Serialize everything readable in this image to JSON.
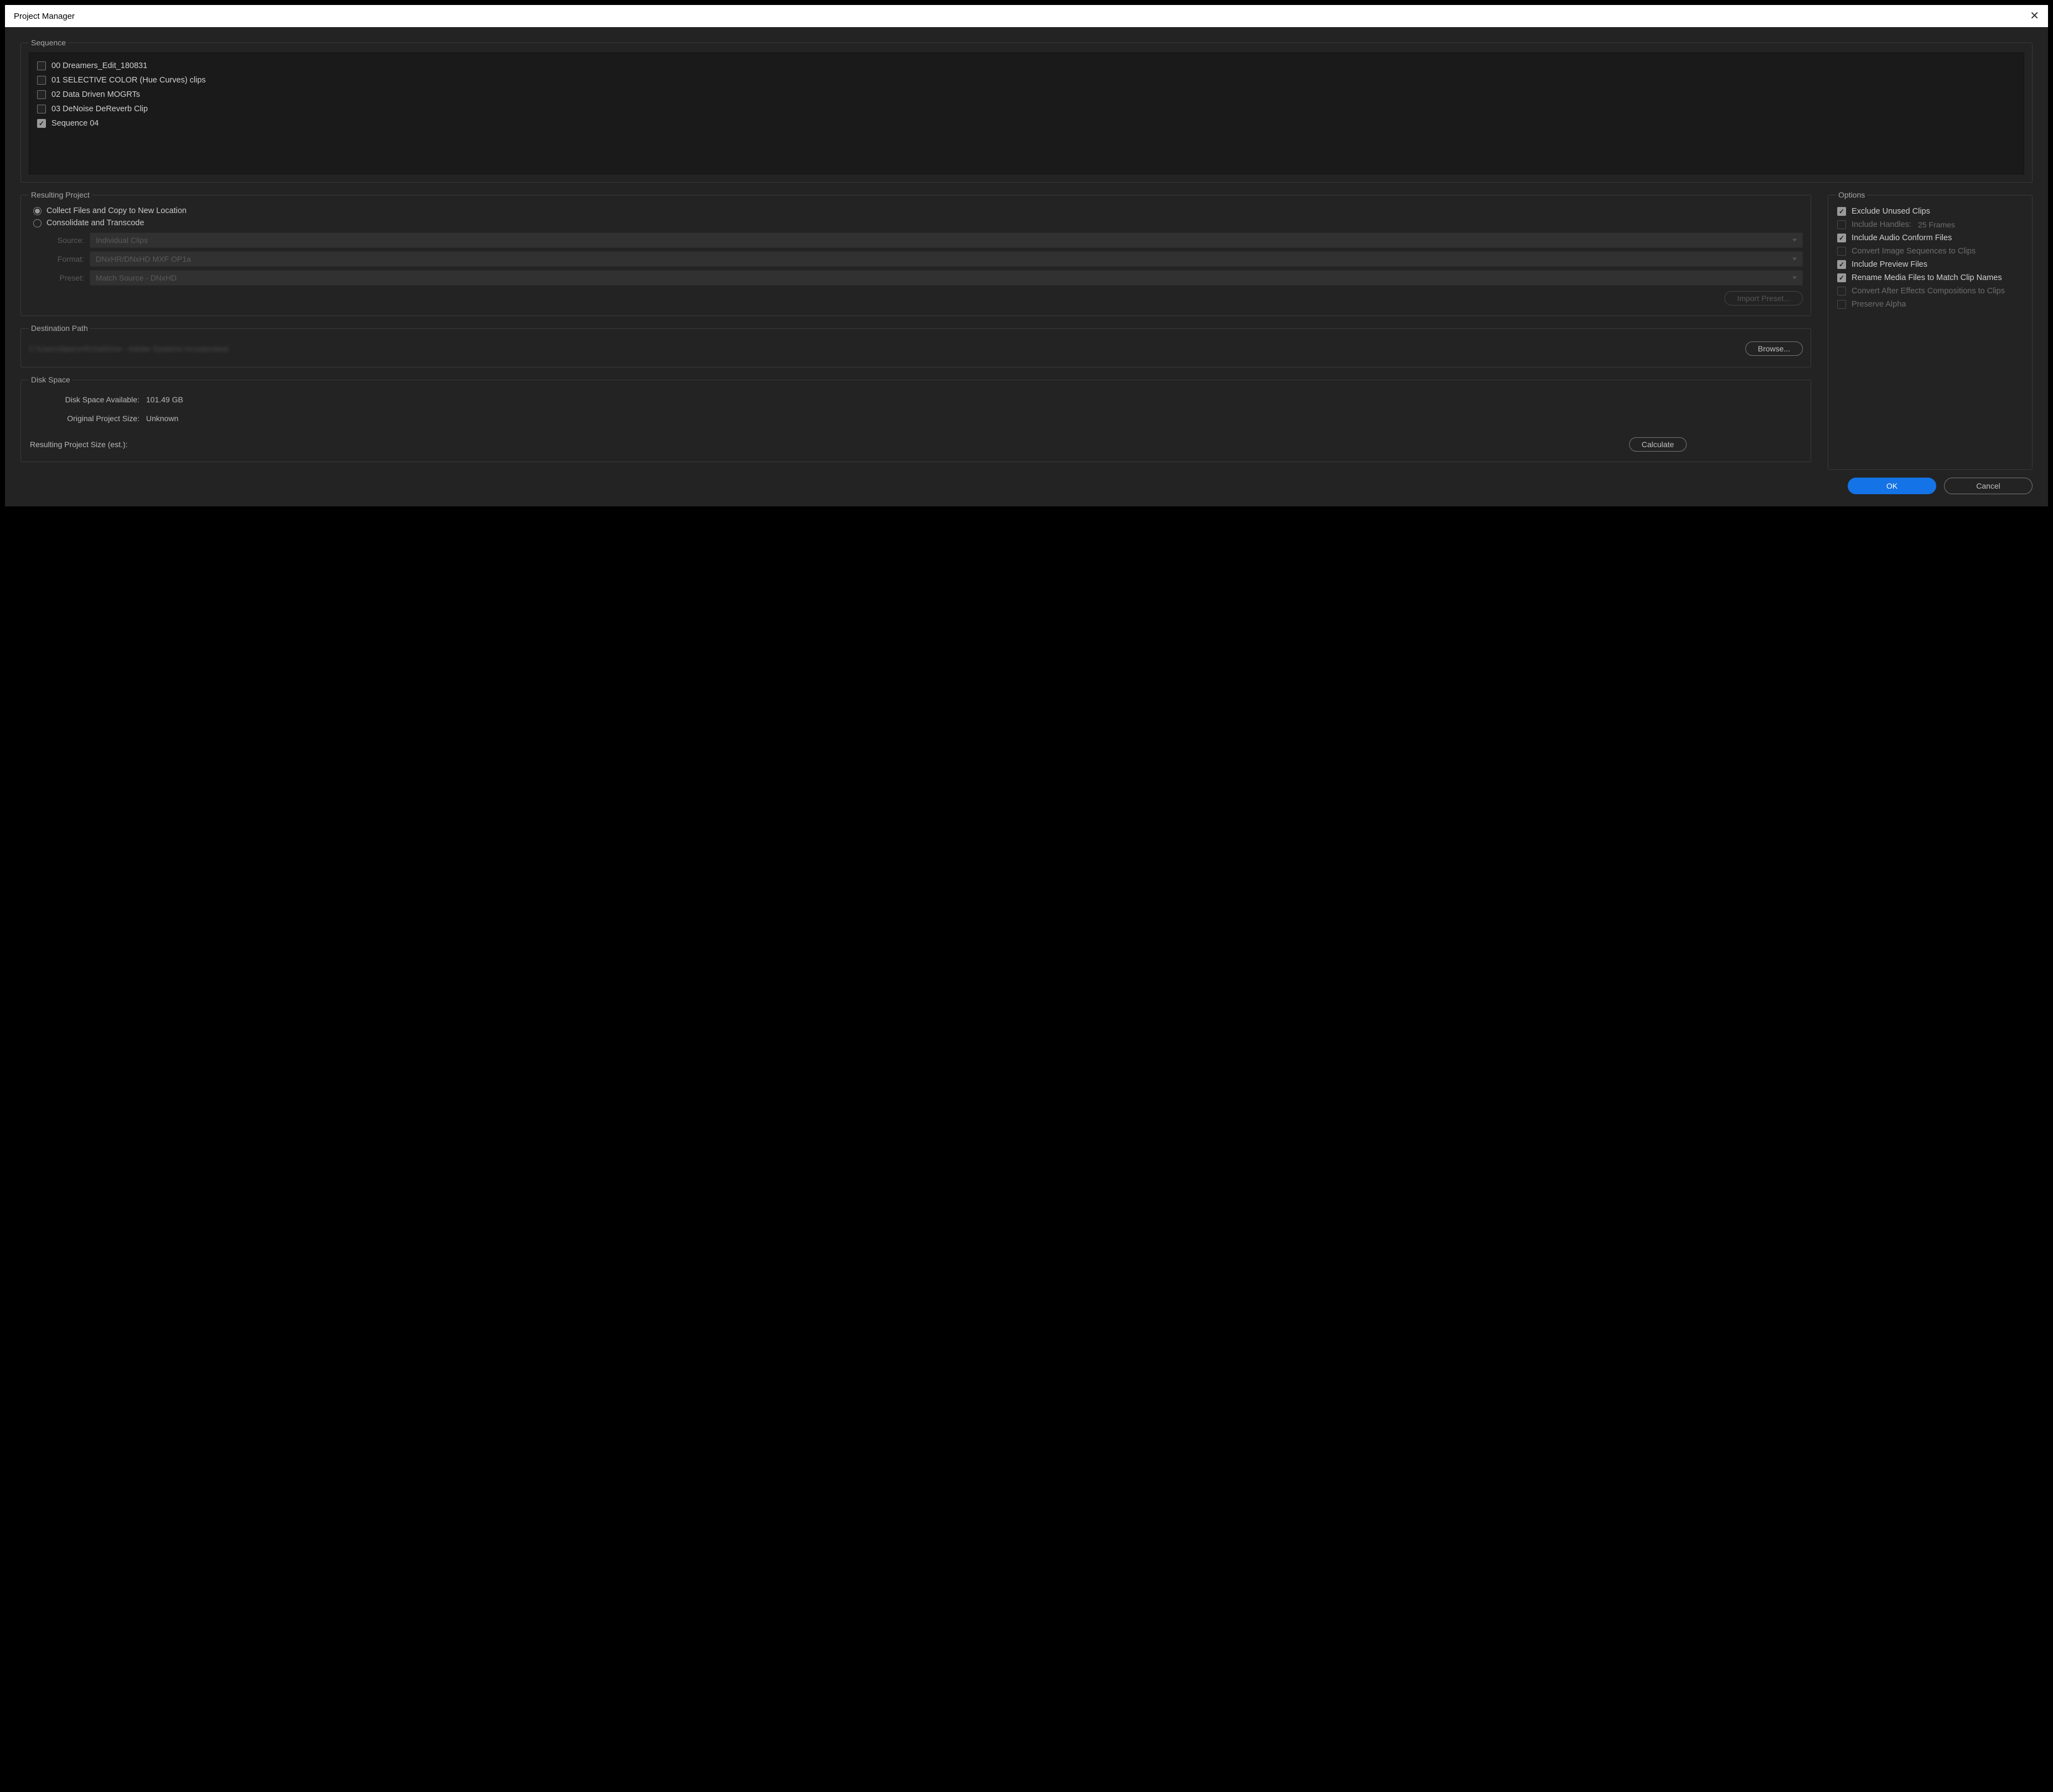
{
  "window": {
    "title": "Project Manager"
  },
  "sequence": {
    "legend": "Sequence",
    "items": [
      {
        "label": "00 Dreamers_Edit_180831",
        "checked": false
      },
      {
        "label": "01 SELECTIVE COLOR (Hue Curves) clips",
        "checked": false
      },
      {
        "label": "02 Data Driven MOGRTs",
        "checked": false
      },
      {
        "label": "03 DeNoise DeReverb Clip",
        "checked": false
      },
      {
        "label": "Sequence 04",
        "checked": true
      }
    ]
  },
  "resulting": {
    "legend": "Resulting Project",
    "radios": [
      {
        "label": "Collect Files and Copy to New Location",
        "selected": true
      },
      {
        "label": "Consolidate and Transcode",
        "selected": false
      }
    ],
    "source_label": "Source:",
    "source_value": "Individual Clips",
    "format_label": "Format:",
    "format_value": "DNxHR/DNxHD MXF OP1a",
    "preset_label": "Preset:",
    "preset_value": "Match Source - DNxHD",
    "import_preset": "Import Preset..."
  },
  "destination": {
    "legend": "Destination Path",
    "path_blurred": "C:\\Users\\bparsnf\\OneDrive - Adobe Systems Incorporated",
    "browse": "Browse..."
  },
  "disk": {
    "legend": "Disk Space",
    "available_label": "Disk Space Available:",
    "available_value": "101.49 GB",
    "original_label": "Original Project Size:",
    "original_value": "Unknown",
    "resulting_label": "Resulting Project Size (est.):",
    "calculate": "Calculate"
  },
  "options": {
    "legend": "Options",
    "items": [
      {
        "label": "Exclude Unused Clips",
        "checked": true,
        "enabled": true
      },
      {
        "label": "Include Handles:",
        "value": "25 Frames",
        "checked": false,
        "enabled": false
      },
      {
        "label": "Include Audio Conform Files",
        "checked": true,
        "enabled": true
      },
      {
        "label": "Convert Image Sequences to Clips",
        "checked": false,
        "enabled": false
      },
      {
        "label": "Include Preview Files",
        "checked": true,
        "enabled": true
      },
      {
        "label": "Rename Media Files to Match Clip Names",
        "checked": true,
        "enabled": true
      },
      {
        "label": "Convert After Effects Compositions to Clips",
        "checked": false,
        "enabled": false
      },
      {
        "label": "Preserve Alpha",
        "checked": false,
        "enabled": false
      }
    ]
  },
  "footer": {
    "ok": "OK",
    "cancel": "Cancel"
  }
}
